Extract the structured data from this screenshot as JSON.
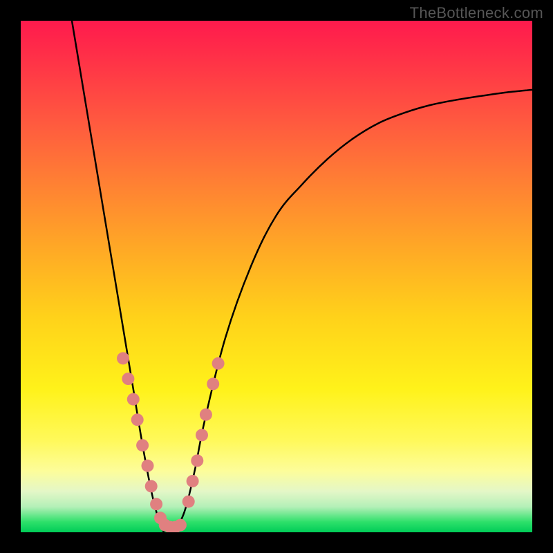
{
  "watermark": "TheBottleneck.com",
  "colors": {
    "background": "#000000",
    "curve": "#000000",
    "points": "#e08080",
    "points_stroke": "#c96a6a"
  },
  "chart_data": {
    "type": "line",
    "title": "",
    "xlabel": "",
    "ylabel": "",
    "xlim": [
      0,
      100
    ],
    "ylim": [
      0,
      100
    ],
    "note": "Two smooth curves forming a V-shape meeting near the green minimum; inverted y-axis (top = 100%). Values estimated from pixels.",
    "series": [
      {
        "name": "left-curve",
        "x": [
          10,
          12,
          14,
          16,
          18,
          20,
          22,
          24,
          26,
          28,
          30
        ],
        "y": [
          100,
          88,
          76,
          64,
          52,
          40,
          28,
          16,
          6,
          0,
          0
        ]
      },
      {
        "name": "right-curve",
        "x": [
          30,
          32,
          34,
          36,
          40,
          45,
          50,
          55,
          60,
          65,
          70,
          75,
          80,
          85,
          90,
          95,
          100
        ],
        "y": [
          0,
          4,
          12,
          22,
          38,
          52,
          62,
          68,
          73,
          77,
          80,
          82,
          83.5,
          84.5,
          85.3,
          86,
          86.5
        ]
      }
    ],
    "points": [
      {
        "name": "left-cluster",
        "x": 20.0,
        "y": 34
      },
      {
        "name": "left-cluster",
        "x": 21.0,
        "y": 30
      },
      {
        "name": "left-cluster",
        "x": 22.0,
        "y": 26
      },
      {
        "name": "left-cluster",
        "x": 22.8,
        "y": 22
      },
      {
        "name": "left-cluster",
        "x": 23.8,
        "y": 17
      },
      {
        "name": "left-cluster",
        "x": 24.8,
        "y": 13
      },
      {
        "name": "left-cluster",
        "x": 25.5,
        "y": 9
      },
      {
        "name": "left-cluster",
        "x": 26.5,
        "y": 5.5
      },
      {
        "name": "left-cluster",
        "x": 27.3,
        "y": 2.8
      },
      {
        "name": "bottom",
        "x": 28.2,
        "y": 1.4
      },
      {
        "name": "bottom",
        "x": 29.2,
        "y": 1.0
      },
      {
        "name": "bottom",
        "x": 30.2,
        "y": 1.0
      },
      {
        "name": "bottom",
        "x": 31.2,
        "y": 1.4
      },
      {
        "name": "right-cluster",
        "x": 32.8,
        "y": 6
      },
      {
        "name": "right-cluster",
        "x": 33.6,
        "y": 10
      },
      {
        "name": "right-cluster",
        "x": 34.5,
        "y": 14
      },
      {
        "name": "right-cluster",
        "x": 35.4,
        "y": 19
      },
      {
        "name": "right-cluster",
        "x": 36.2,
        "y": 23
      },
      {
        "name": "right-cluster",
        "x": 37.6,
        "y": 29
      },
      {
        "name": "right-cluster",
        "x": 38.6,
        "y": 33
      }
    ]
  }
}
